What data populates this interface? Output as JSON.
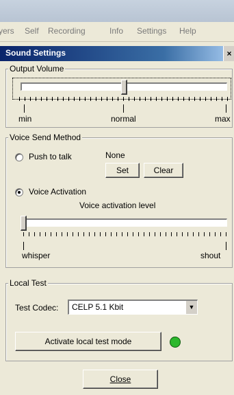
{
  "menu": [
    "yers",
    "Self",
    "Recording",
    "Info",
    "Settings",
    "Help"
  ],
  "dialog": {
    "title": "Sound Settings",
    "close_glyph": "×"
  },
  "output_volume": {
    "label": "Output Volume",
    "min_label": "min",
    "mid_label": "normal",
    "max_label": "max",
    "level": 0.5
  },
  "voice_send": {
    "label": "Voice Send Method",
    "push_to_talk_label": "Push to talk",
    "hotkey_value": "None",
    "set_label": "Set",
    "clear_label": "Clear",
    "voice_activation_label": "Voice Activation",
    "selected": "Voice Activation",
    "activation_level_label": "Voice activation level",
    "whisper_label": "whisper",
    "shout_label": "shout",
    "activation_level": 0.0
  },
  "local_test": {
    "label": "Local Test",
    "codec_label": "Test Codec:",
    "codec_value": "CELP 5.1 Kbit",
    "activate_label": "Activate local test mode",
    "status_color": "#2db82d"
  },
  "footer": {
    "close_label": "Close"
  }
}
